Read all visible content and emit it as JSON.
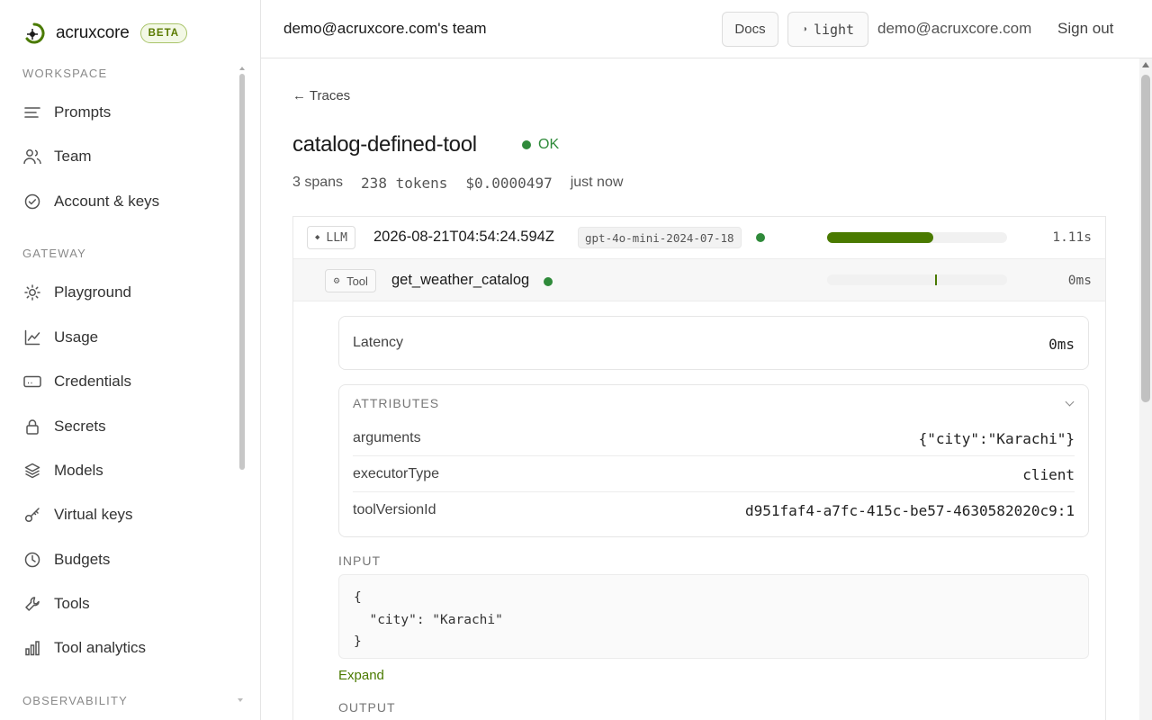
{
  "brand": {
    "name": "acruxcore",
    "badge": "BETA"
  },
  "sidebar": {
    "sections": [
      {
        "label": "WORKSPACE",
        "items": [
          {
            "label": "Prompts",
            "icon": "lines-icon"
          },
          {
            "label": "Team",
            "icon": "users-icon"
          },
          {
            "label": "Account & keys",
            "icon": "check-circle-icon"
          }
        ]
      },
      {
        "label": "GATEWAY",
        "items": [
          {
            "label": "Playground",
            "icon": "sun-icon"
          },
          {
            "label": "Usage",
            "icon": "chart-icon"
          },
          {
            "label": "Credentials",
            "icon": "card-icon"
          },
          {
            "label": "Secrets",
            "icon": "lock-icon"
          },
          {
            "label": "Models",
            "icon": "layers-icon"
          },
          {
            "label": "Virtual keys",
            "icon": "key-icon"
          },
          {
            "label": "Budgets",
            "icon": "clock-icon"
          },
          {
            "label": "Tools",
            "icon": "wrench-icon"
          },
          {
            "label": "Tool analytics",
            "icon": "bars-icon"
          }
        ]
      },
      {
        "label": "OBSERVABILITY",
        "items": []
      }
    ]
  },
  "header": {
    "team": "demo@acruxcore.com's team",
    "docs": "Docs",
    "theme": "light",
    "email": "demo@acruxcore.com",
    "signout": "Sign out"
  },
  "trace": {
    "back": "← Traces",
    "title": "catalog-defined-tool",
    "status": "OK",
    "status_color": "#2f8a3a",
    "meta": {
      "spans": "3 spans",
      "tokens": "238 tokens",
      "cost": "$0.0000497",
      "time": "just now"
    },
    "spans": [
      {
        "kind": "LLM",
        "name": "2026-08-21T04:54:24.594Z",
        "model": "gpt-4o-mini-2024-07-18",
        "duration": "1.11s",
        "progress": 0.59
      },
      {
        "kind": "Tool",
        "name": "get_weather_catalog",
        "duration": "0ms"
      }
    ],
    "detail": {
      "latency_label": "Latency",
      "latency_value": "0ms",
      "attributes_label": "ATTRIBUTES",
      "attributes": [
        {
          "key": "arguments",
          "value": "{\"city\":\"Karachi\"}"
        },
        {
          "key": "executorType",
          "value": "client"
        },
        {
          "key": "toolVersionId",
          "value": "d951faf4-a7fc-415c-be57-4630582020c9:1"
        }
      ],
      "input_label": "INPUT",
      "input_code": "{\n  \"city\": \"Karachi\"\n}",
      "expand": "Expand",
      "output_label": "OUTPUT"
    }
  },
  "colors": {
    "accent": "#4a7a00",
    "ok": "#2f8a3a"
  }
}
